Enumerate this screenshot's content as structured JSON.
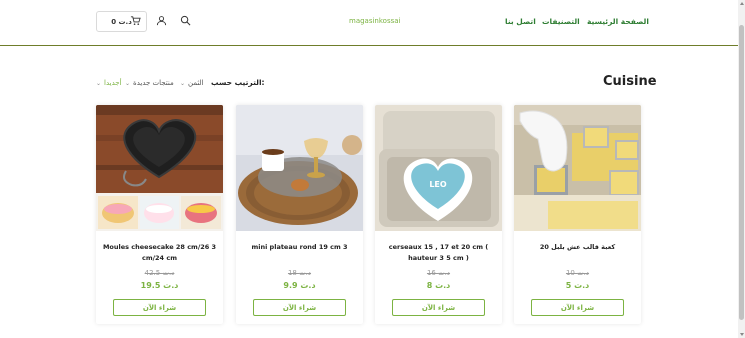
{
  "header": {
    "cart_total": "0 د.ت",
    "site_name": "magasinkossai",
    "nav": [
      "الصفحة الرئيسية",
      "التصنيفات",
      "اتصل بنا"
    ]
  },
  "page": {
    "title": "Cuisine",
    "sort_label": "الترتيب حسب:",
    "filters": [
      "الثمن",
      "منتجات جديدة",
      "أجديدا"
    ]
  },
  "products": [
    {
      "name": "Moules cheesecake 28 cm/26 3 cm/24 cm",
      "old_price": "42.5 د.ت",
      "price": "19.5 د.ت",
      "buy": "شراء الآن"
    },
    {
      "name": "mini plateau rond 19 cm 3",
      "old_price": "18 د.ت",
      "price": "9.9 د.ت",
      "buy": "شراء الآن"
    },
    {
      "name": "cerseaux 15 , 17 et 20 cm ( hauteur 3 5 cm )",
      "old_price": "16 د.ت",
      "price": "8 د.ت",
      "buy": "شراء الآن"
    },
    {
      "name": "20 كعبة قالب عش بلبل",
      "old_price": "10 د.ت",
      "price": "5 د.ت",
      "buy": "شراء الآن"
    }
  ],
  "colors": {
    "accent": "#7cb342",
    "nav": "#2e7d32",
    "divider": "#6f7d2a"
  }
}
